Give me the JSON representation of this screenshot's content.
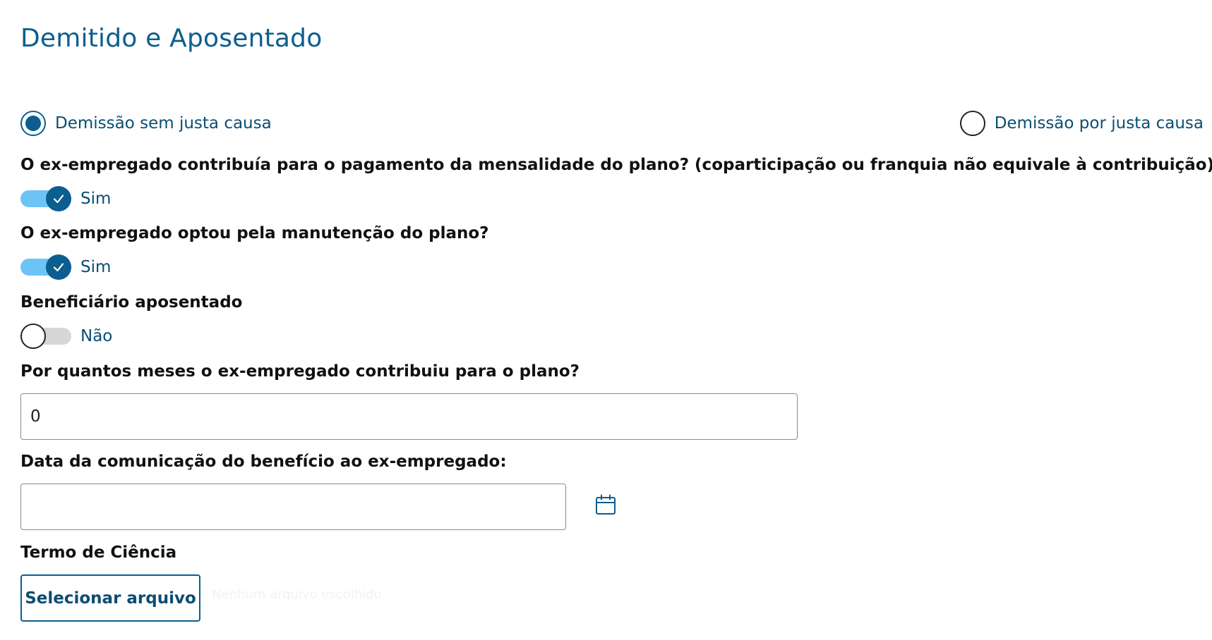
{
  "page": {
    "title": "Demitido e Aposentado"
  },
  "dismissal_type": {
    "options": [
      {
        "label": "Demissão sem justa causa",
        "selected": true
      },
      {
        "label": "Demissão por justa causa",
        "selected": false
      }
    ]
  },
  "questions": {
    "contributed": {
      "label": "O ex-empregado contribuía para o pagamento da mensalidade do plano? (coparticipação ou franquia não equivale à contribuição)",
      "toggle_on": true,
      "toggle_label": "Sim"
    },
    "kept_plan": {
      "label": "O ex-empregado optou pela manutenção do plano?",
      "toggle_on": true,
      "toggle_label": "Sim"
    },
    "retired": {
      "label": "Beneficiário aposentado",
      "toggle_on": false,
      "toggle_label": "Não"
    },
    "months": {
      "label": "Por quantos meses o ex-empregado contribuiu para o plano?",
      "value": "0"
    },
    "communication_date": {
      "label": "Data da comunicação do benefício ao ex-empregado:",
      "value": ""
    },
    "term": {
      "label": "Termo de Ciência",
      "button_label": "Selecionar arquivo",
      "file_status": "Nenhum arquivo escolhido"
    }
  },
  "icons": {
    "radio_selected": "radio-selected-icon",
    "radio_unselected": "radio-unselected-icon",
    "toggle_check": "check-icon",
    "calendar": "calendar-icon"
  },
  "colors": {
    "primary": "#0b5e8f",
    "title": "#0c5e8d",
    "label": "#0b4d73",
    "toggle_track_on": "#6cc3f5",
    "toggle_track_off": "#d6d6d6"
  }
}
